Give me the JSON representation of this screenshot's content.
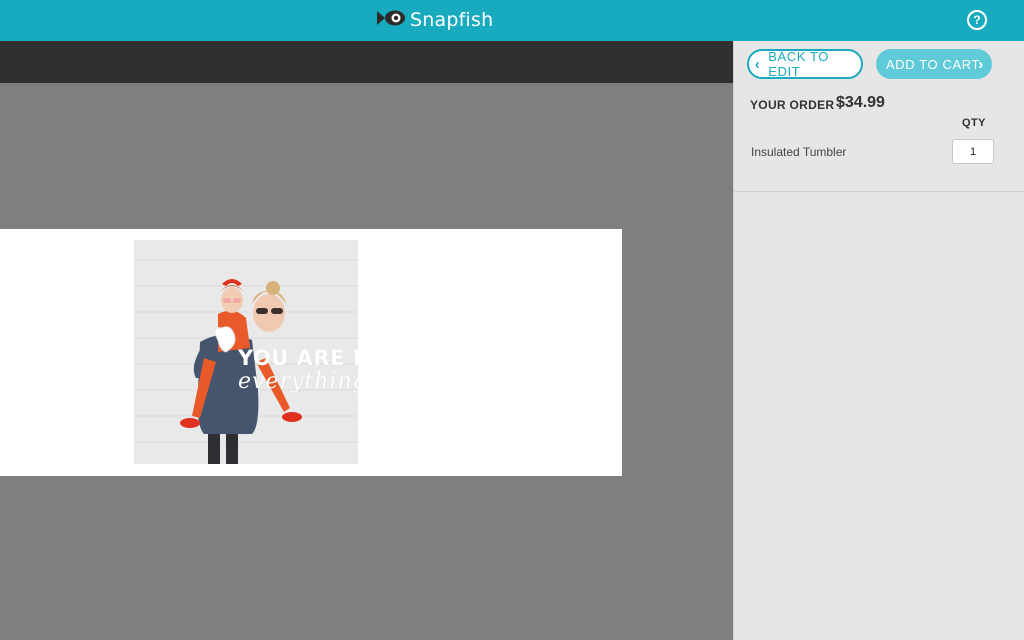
{
  "header": {
    "brand": "Snapfish",
    "help_icon": "?"
  },
  "sidebar": {
    "back_button": "BACK TO EDIT",
    "add_button": "ADD TO CART",
    "order_label": "YOUR ORDER :",
    "order_price": "$34.99",
    "qty_header": "QTY",
    "items": [
      {
        "name": "Insulated Tumbler",
        "qty": "1"
      }
    ]
  },
  "design": {
    "line1": "YOU ARE MY",
    "line2": "everything"
  },
  "colors": {
    "brand": "#18aabe",
    "add_button": "#5fcbd8",
    "canvas": "#7f7f7f",
    "toolbar": "#303030"
  },
  "icons": {
    "logo": "snapfish-fish-icon",
    "help": "help-icon",
    "back": "chevron-left-icon",
    "forward": "chevron-right-icon"
  }
}
